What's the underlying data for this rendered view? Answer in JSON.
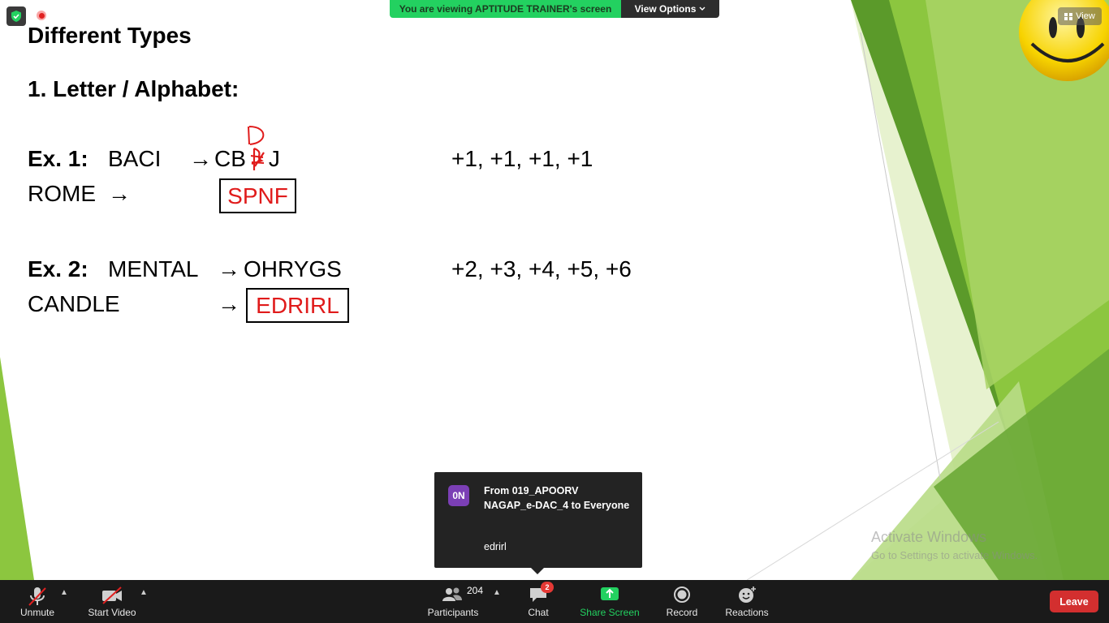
{
  "meeting_bar": {
    "viewing_text": "You are viewing APTITUDE TRAINER's screen",
    "view_options_label": "View Options",
    "view_button_label": "View"
  },
  "slide": {
    "title": "Different Types",
    "section": "1.  Letter / Alphabet:",
    "ex1": {
      "label": "Ex. 1:",
      "word": "BACI",
      "arrow": "→",
      "result_prefix": "CB",
      "result_suffix": "J",
      "handwritten_letter": "D",
      "pattern": "+1, +1, +1, +1",
      "question": "ROME",
      "question_arrow": "→",
      "answer": "SPNF"
    },
    "ex2": {
      "label": "Ex. 2:",
      "word": "MENTAL",
      "arrow": "→",
      "result": "OHRYGS",
      "pattern": "+2, +3, +4, +5, +6",
      "question": "CANDLE",
      "question_arrow": "→",
      "answer": "EDRIRL"
    }
  },
  "watermark": {
    "line1": "Activate Windows",
    "line2": "Go to Settings to activate Windows."
  },
  "chat_popup": {
    "avatar_initials": "0N",
    "from_text": "From 019_APOORV NAGAP_e-DAC_4 to Everyone",
    "message": "edrirl"
  },
  "toolbar": {
    "unmute_label": "Unmute",
    "start_video_label": "Start Video",
    "participants_label": "Participants",
    "participants_count": "204",
    "chat_label": "Chat",
    "chat_badge": "2",
    "share_screen_label": "Share Screen",
    "record_label": "Record",
    "reactions_label": "Reactions",
    "leave_label": "Leave"
  },
  "colors": {
    "accent_green": "#23d160",
    "leave_red": "#d32f2f",
    "answer_red": "#e01b1b",
    "avatar_purple": "#7b3fb5"
  }
}
